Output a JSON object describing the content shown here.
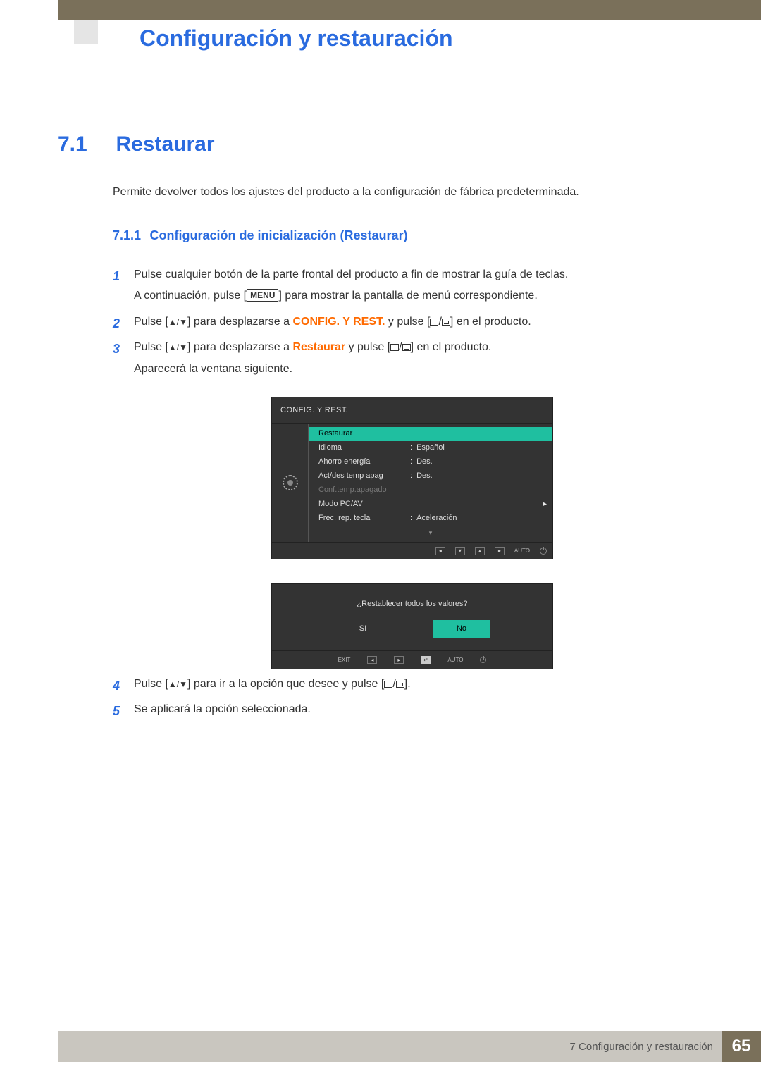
{
  "chapter_title": "Configuración y restauración",
  "section": {
    "num": "7.1",
    "title": "Restaurar"
  },
  "intro": "Permite devolver todos los ajustes del producto a la configuración de fábrica predeterminada.",
  "subsection": {
    "num": "7.1.1",
    "title": "Configuración de inicialización (Restaurar)"
  },
  "steps": {
    "s1": "Pulse cualquier botón de la parte frontal del producto a fin de mostrar la guía de teclas.",
    "s1b_a": "A continuación, pulse [",
    "s1b_menu": "MENU",
    "s1b_b": "] para mostrar la pantalla de menú correspondiente.",
    "s2_a": "Pulse [",
    "s2_b": "] para desplazarse a ",
    "s2_bold": "CONFIG. Y REST.",
    "s2_c": " y pulse [",
    "s2_d": "] en el producto.",
    "s3_a": "Pulse [",
    "s3_b": "] para desplazarse a ",
    "s3_bold": "Restaurar",
    "s3_c": " y pulse [",
    "s3_d": "] en el producto.",
    "s3_e": "Aparecerá la ventana siguiente.",
    "s4_a": "Pulse [",
    "s4_b": "] para ir a la opción que desee y pulse [",
    "s4_c": "].",
    "s5": "Se aplicará la opción seleccionada."
  },
  "osd": {
    "header": "CONFIG. Y REST.",
    "rows": [
      {
        "label": "Restaurar",
        "val": "",
        "sel": true
      },
      {
        "label": "Idioma",
        "val": "Español"
      },
      {
        "label": "Ahorro energía",
        "val": "Des."
      },
      {
        "label": "Act/des temp apag",
        "val": "Des."
      },
      {
        "label": "Conf.temp.apagado",
        "val": "",
        "dim": true
      },
      {
        "label": "Modo PC/AV",
        "val": ""
      },
      {
        "label": "Frec. rep. tecla",
        "val": "Aceleración"
      }
    ],
    "footer_auto": "AUTO"
  },
  "osd2": {
    "question": "¿Restablecer todos los valores?",
    "yes": "Sí",
    "no": "No",
    "exit": "EXIT",
    "auto": "AUTO"
  },
  "footer": {
    "label": "7 Configuración y restauración",
    "page": "65"
  }
}
